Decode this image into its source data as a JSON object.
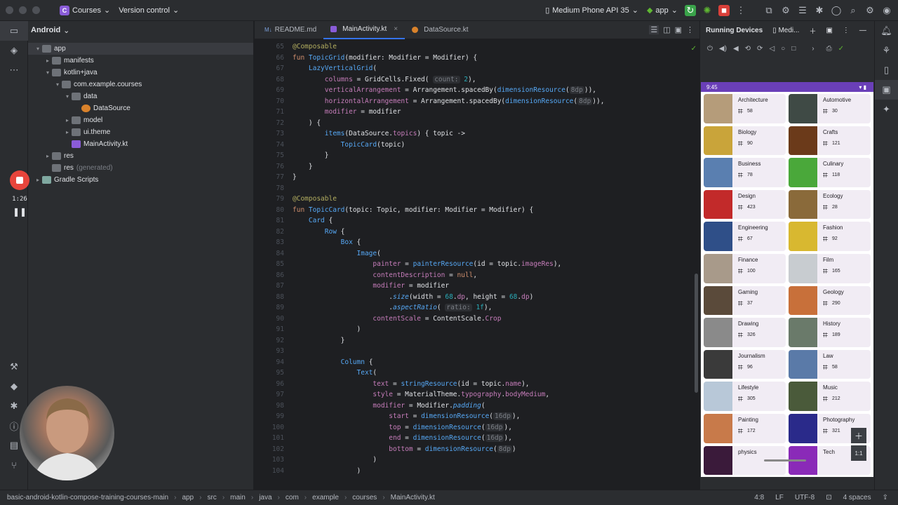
{
  "titlebar": {
    "project_badge": "C",
    "project": "Courses",
    "vcs": "Version control",
    "device": "Medium Phone API 35",
    "run_config": "app"
  },
  "project_panel": {
    "title": "Android",
    "tree": [
      {
        "label": "app",
        "indent": 0,
        "arrow": "▾",
        "icon": "folder",
        "sel": true
      },
      {
        "label": "manifests",
        "indent": 1,
        "arrow": "▸",
        "icon": "folder"
      },
      {
        "label": "kotlin+java",
        "indent": 1,
        "arrow": "▾",
        "icon": "folder"
      },
      {
        "label": "com.example.courses",
        "indent": 2,
        "arrow": "▾",
        "icon": "folder"
      },
      {
        "label": "data",
        "indent": 3,
        "arrow": "▾",
        "icon": "folder"
      },
      {
        "label": "DataSource",
        "indent": 4,
        "arrow": "",
        "icon": "ds"
      },
      {
        "label": "model",
        "indent": 3,
        "arrow": "▸",
        "icon": "folder"
      },
      {
        "label": "ui.theme",
        "indent": 3,
        "arrow": "▸",
        "icon": "folder"
      },
      {
        "label": "MainActivity.kt",
        "indent": 3,
        "arrow": "",
        "icon": "kt"
      },
      {
        "label": "res",
        "indent": 1,
        "arrow": "▸",
        "icon": "folder"
      },
      {
        "label": "res",
        "suffix": "(generated)",
        "indent": 1,
        "arrow": "",
        "icon": "folder"
      },
      {
        "label": "Gradle Scripts",
        "indent": 0,
        "arrow": "▸",
        "icon": "gradle"
      }
    ]
  },
  "recorder": {
    "time": "1:26"
  },
  "editor": {
    "tabs": [
      {
        "label": "README.md",
        "active": false
      },
      {
        "label": "MainActivity.kt",
        "active": true
      },
      {
        "label": "DataSource.kt",
        "active": false
      }
    ]
  },
  "code": [
    {
      "n": "65",
      "html": "<span class=\"ann\">@Composable</span>"
    },
    {
      "n": "66",
      "html": "<span class=\"kw\">fun</span> <span class=\"fn\">TopicGrid</span>(modifier: Modifier = Modifier) {"
    },
    {
      "n": "67",
      "html": "    <span class=\"fn\">LazyVerticalGrid</span>("
    },
    {
      "n": "68",
      "html": "        <span class=\"pr\">columns</span> = GridCells.Fixed( <span class=\"hint\">count:</span> <span class=\"nm\">2</span>),"
    },
    {
      "n": "69",
      "html": "        <span class=\"pr\">verticalArrangement</span> = Arrangement.spacedBy(<span class=\"fn\">dimensionResource</span>(<span class=\"hint\">8dp</span>)),"
    },
    {
      "n": "70",
      "html": "        <span class=\"pr\">horizontalArrangement</span> = Arrangement.spacedBy(<span class=\"fn\">dimensionResource</span>(<span class=\"hint\">8dp</span>)),"
    },
    {
      "n": "71",
      "html": "        <span class=\"pr\">modifier</span> = modifier"
    },
    {
      "n": "72",
      "html": "    ) {"
    },
    {
      "n": "73",
      "html": "        <span class=\"fn\">items</span>(DataSource.<span class=\"pr\">topics</span>) { topic ->"
    },
    {
      "n": "74",
      "html": "            <span class=\"fn\">TopicCard</span>(topic)"
    },
    {
      "n": "75",
      "html": "        }"
    },
    {
      "n": "76",
      "html": "    }"
    },
    {
      "n": "77",
      "html": "}"
    },
    {
      "n": "78",
      "html": ""
    },
    {
      "n": "79",
      "html": "<span class=\"ann\">@Composable</span>"
    },
    {
      "n": "80",
      "html": "<span class=\"kw\">fun</span> <span class=\"fn\">TopicCard</span>(topic: Topic, modifier: Modifier = Modifier) {"
    },
    {
      "n": "81",
      "html": "    <span class=\"fn\">Card</span> {"
    },
    {
      "n": "82",
      "html": "        <span class=\"fn\">Row</span> {"
    },
    {
      "n": "83",
      "html": "            <span class=\"fn\">Box</span> {"
    },
    {
      "n": "84",
      "html": "                <span class=\"fn\">Image</span>("
    },
    {
      "n": "85",
      "html": "                    <span class=\"pr\">painter</span> = <span class=\"fn\">painterResource</span>(id = topic.<span class=\"pr\">imageRes</span>),"
    },
    {
      "n": "86",
      "html": "                    <span class=\"pr\">contentDescription</span> = <span class=\"kw\">null</span>,"
    },
    {
      "n": "87",
      "html": "                    <span class=\"pr\">modifier</span> = modifier"
    },
    {
      "n": "88",
      "html": "                        .<span class=\"it\">size</span>(width = <span class=\"nm\">68</span>.<span class=\"pr\">dp</span>, height = <span class=\"nm\">68</span>.<span class=\"pr\">dp</span>)"
    },
    {
      "n": "89",
      "html": "                        .<span class=\"it\">aspectRatio</span>( <span class=\"hint\">ratio:</span> <span class=\"nm\">1f</span>),"
    },
    {
      "n": "90",
      "html": "                    <span class=\"pr\">contentScale</span> = ContentScale.<span class=\"pr\">Crop</span>"
    },
    {
      "n": "91",
      "html": "                )"
    },
    {
      "n": "92",
      "html": "            }"
    },
    {
      "n": "93",
      "html": ""
    },
    {
      "n": "94",
      "html": "            <span class=\"fn\">Column</span> {"
    },
    {
      "n": "95",
      "html": "                <span class=\"fn\">Text</span>("
    },
    {
      "n": "96",
      "html": "                    <span class=\"pr\">text</span> = <span class=\"fn\">stringResource</span>(id = topic.<span class=\"pr\">name</span>),"
    },
    {
      "n": "97",
      "html": "                    <span class=\"pr\">style</span> = MaterialTheme.<span class=\"pr\">typography</span>.<span class=\"pr\">bodyMedium</span>,"
    },
    {
      "n": "98",
      "html": "                    <span class=\"pr\">modifier</span> = Modifier.<span class=\"it\">padding</span>("
    },
    {
      "n": "99",
      "html": "                        <span class=\"pr\">start</span> = <span class=\"fn\">dimensionResource</span>(<span class=\"hint\">16dp</span>),"
    },
    {
      "n": "100",
      "html": "                        <span class=\"pr\">top</span> = <span class=\"fn\">dimensionResource</span>(<span class=\"hint\">16dp</span>),"
    },
    {
      "n": "101",
      "html": "                        <span class=\"pr\">end</span> = <span class=\"fn\">dimensionResource</span>(<span class=\"hint\">16dp</span>),"
    },
    {
      "n": "102",
      "html": "                        <span class=\"pr\">bottom</span> = <span class=\"fn\">dimensionResource</span>(<span class=\"hint\">8dp</span>)"
    },
    {
      "n": "103",
      "html": "                    )"
    },
    {
      "n": "104",
      "html": "                )"
    }
  ],
  "running_devices": {
    "title": "Running Devices",
    "tab": "Medi...",
    "status_time": "9:45"
  },
  "topics": [
    {
      "name": "Architecture",
      "count": "58",
      "color": "#b59c7a"
    },
    {
      "name": "Automotive",
      "count": "30",
      "color": "#3f4a45"
    },
    {
      "name": "Biology",
      "count": "90",
      "color": "#c9a43a"
    },
    {
      "name": "Crafts",
      "count": "121",
      "color": "#6b3a1a"
    },
    {
      "name": "Business",
      "count": "78",
      "color": "#5a7fb0"
    },
    {
      "name": "Culinary",
      "count": "118",
      "color": "#4aa83a"
    },
    {
      "name": "Design",
      "count": "423",
      "color": "#c22a2a"
    },
    {
      "name": "Ecology",
      "count": "28",
      "color": "#8a6a3a"
    },
    {
      "name": "Engineering",
      "count": "67",
      "color": "#2f4f88"
    },
    {
      "name": "Fashion",
      "count": "92",
      "color": "#d8b830"
    },
    {
      "name": "Finance",
      "count": "100",
      "color": "#a89a8a"
    },
    {
      "name": "Film",
      "count": "165",
      "color": "#c8ccd0"
    },
    {
      "name": "Gaming",
      "count": "37",
      "color": "#5a4a3a"
    },
    {
      "name": "Geology",
      "count": "290",
      "color": "#c8703a"
    },
    {
      "name": "Drawing",
      "count": "326",
      "color": "#8a8a8a"
    },
    {
      "name": "History",
      "count": "189",
      "color": "#6a7a6a"
    },
    {
      "name": "Journalism",
      "count": "96",
      "color": "#3a3a3a"
    },
    {
      "name": "Law",
      "count": "58",
      "color": "#5a7aa8"
    },
    {
      "name": "Lifestyle",
      "count": "305",
      "color": "#b8c8d8"
    },
    {
      "name": "Music",
      "count": "212",
      "color": "#4a5a3a"
    },
    {
      "name": "Painting",
      "count": "172",
      "color": "#c87a4a"
    },
    {
      "name": "Photography",
      "count": "321",
      "color": "#2a2a8a"
    },
    {
      "name": "physics",
      "count": "",
      "color": "#3a1a3a"
    },
    {
      "name": "Tech",
      "count": "",
      "color": "#8a2ab8"
    }
  ],
  "zoom_label": "1:1",
  "bottombar": {
    "crumbs": [
      "basic-android-kotlin-compose-training-courses-main",
      "app",
      "src",
      "main",
      "java",
      "com",
      "example",
      "courses",
      "MainActivity.kt"
    ],
    "position": "4:8",
    "line_sep": "LF",
    "encoding": "UTF-8",
    "indent": "4 spaces"
  }
}
